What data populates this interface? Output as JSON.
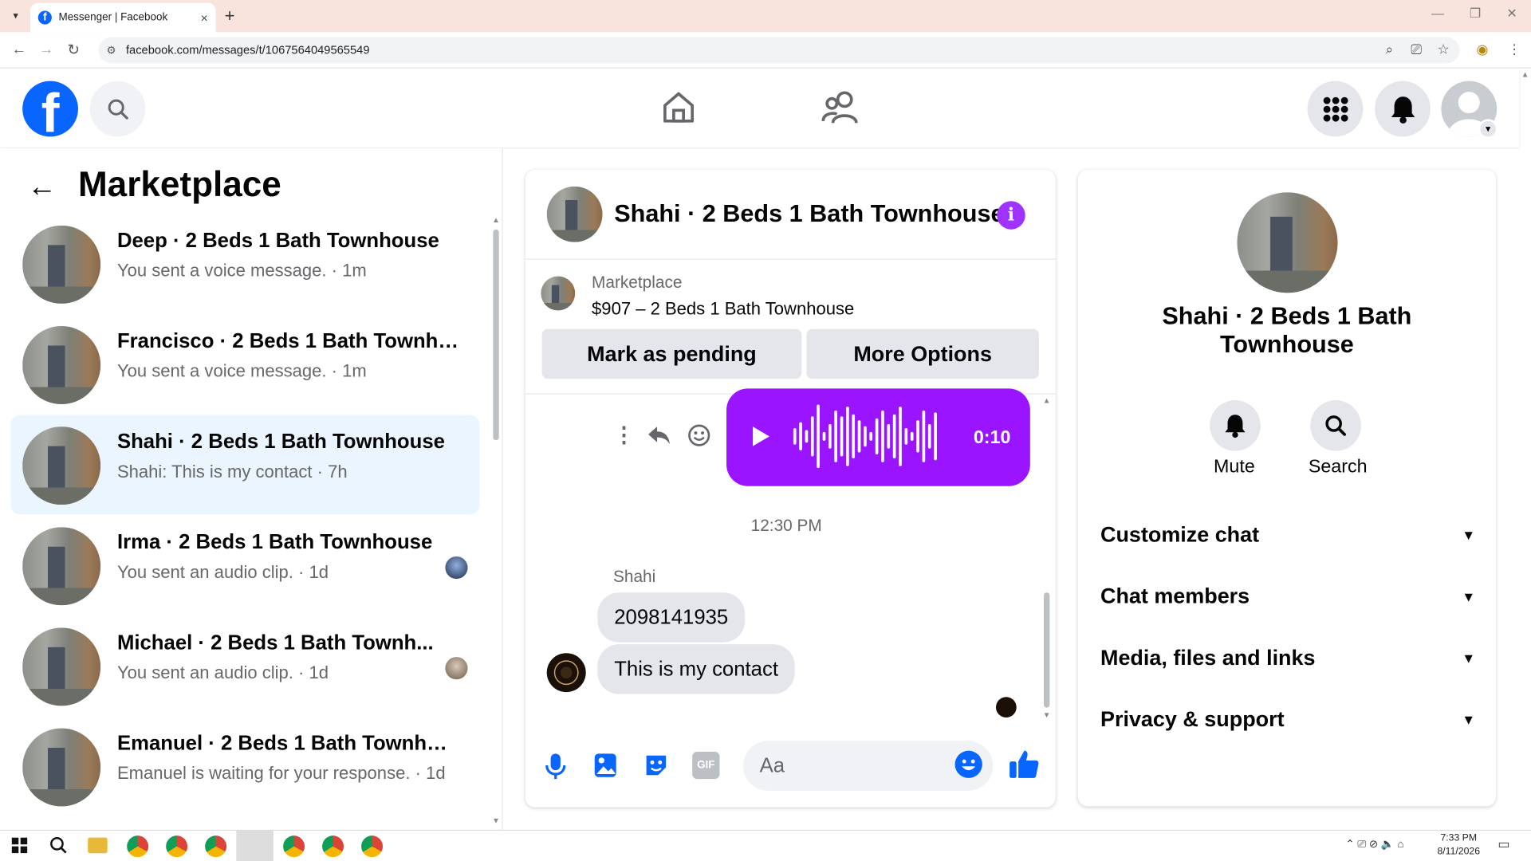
{
  "browser": {
    "tab_title": "Messenger | Facebook",
    "tab_favicon": "f",
    "url": "facebook.com/messages/t/1067564049565549",
    "tab_close": "×",
    "new_tab": "+",
    "minimize": "—",
    "restore": "❐",
    "close": "✕"
  },
  "sidebar": {
    "back_icon": "←",
    "title": "Marketplace",
    "conversations": [
      {
        "name": "Deep · 2 Beds 1 Bath Townhouse",
        "preview": "You sent a voice message. · 1m"
      },
      {
        "name": "Francisco · 2 Beds 1 Bath Townho...",
        "preview": "You sent a voice message. · 1m"
      },
      {
        "name": "Shahi · 2 Beds 1 Bath Townhouse",
        "preview": "Shahi: This is my contact · 7h"
      },
      {
        "name": "Irma · 2 Beds 1 Bath Townhouse",
        "preview": "You sent an audio clip. · 1d"
      },
      {
        "name": "Michael · 2 Beds 1 Bath Townh...",
        "preview": "You sent an audio clip. · 1d"
      },
      {
        "name": "Emanuel · 2 Beds 1 Bath Townhou...",
        "preview": "Emanuel is waiting for your response. · 1d"
      }
    ]
  },
  "chat": {
    "title": "Shahi · 2 Beds 1 Bath Townhouse",
    "info_icon": "i",
    "marketplace_label": "Marketplace",
    "listing": "$907 – 2 Beds 1 Bath Townhouse",
    "mark_pending": "Mark as pending",
    "more_options": "More Options",
    "voice_duration": "0:10",
    "timestamp": "12:30 PM",
    "sender": "Shahi",
    "messages": [
      "2098141935",
      "This is my contact"
    ],
    "composer_placeholder": "Aa"
  },
  "info_panel": {
    "name": "Shahi · 2 Beds 1 Bath Townhouse",
    "mute": "Mute",
    "search": "Search",
    "sections": [
      "Customize chat",
      "Chat members",
      "Media, files and links",
      "Privacy & support"
    ]
  },
  "taskbar": {
    "time": "7:33 PM",
    "date": "8/11/2026"
  },
  "colors": {
    "facebook_blue": "#0866ff",
    "messenger_purple": "#9a14ff",
    "selected_row": "#ebf5ff"
  }
}
